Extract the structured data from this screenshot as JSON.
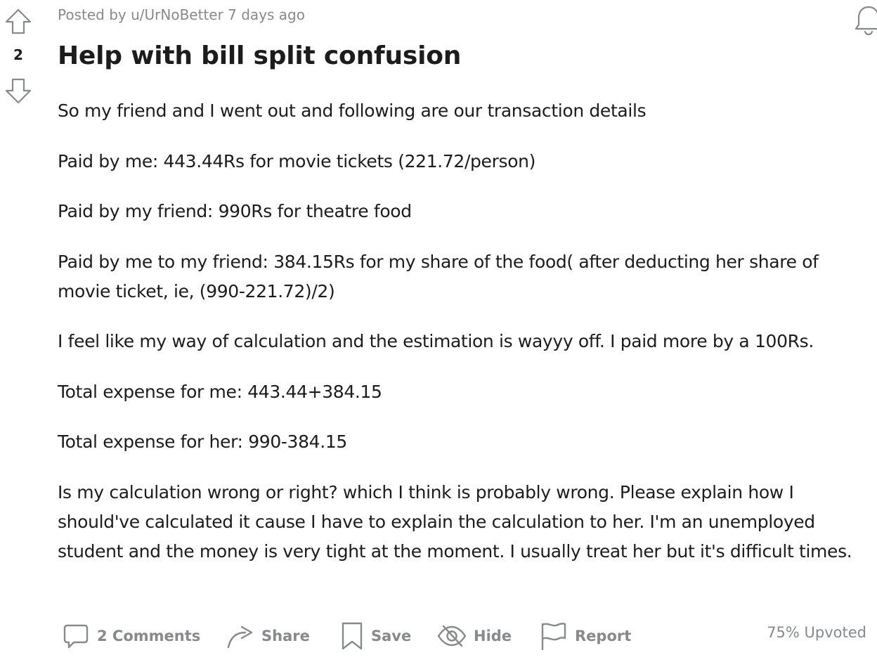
{
  "post": {
    "meta": "Posted by u/UrNoBetter 7 days ago",
    "score": "2",
    "title": "Help with bill split confusion",
    "paragraphs": [
      "So my friend and I went out and following are our transaction details",
      "Paid by me: 443.44Rs for movie tickets (221.72/person)",
      "Paid by my friend: 990Rs for theatre food",
      "Paid by me to my friend: 384.15Rs for my share of the food( after deducting her share of movie ticket, ie, (990-221.72)/2)",
      "I feel like my way of calculation and the estimation is wayyy off. I paid more by a 100Rs.",
      "Total expense for me: 443.44+384.15",
      "Total expense for her: 990-384.15",
      "Is my calculation wrong or right? which I think is probably wrong. Please explain how I should've calculated it cause I have to explain the calculation to her. I'm an unemployed student and the money is very tight at the moment. I usually treat her but it's difficult times."
    ]
  },
  "actions": {
    "comments": "2 Comments",
    "share": "Share",
    "save": "Save",
    "hide": "Hide",
    "report": "Report",
    "upvoted": "75% Upvoted"
  },
  "icons": {
    "upvote": "arrow-up-icon",
    "downvote": "arrow-down-icon",
    "notifications": "bell-icon",
    "comments": "comment-bubble-icon",
    "share": "share-arrow-icon",
    "save": "bookmark-icon",
    "hide": "eye-slash-icon",
    "report": "flag-icon"
  },
  "colors": {
    "text": "#1c1c1c",
    "muted": "#878a8c"
  }
}
